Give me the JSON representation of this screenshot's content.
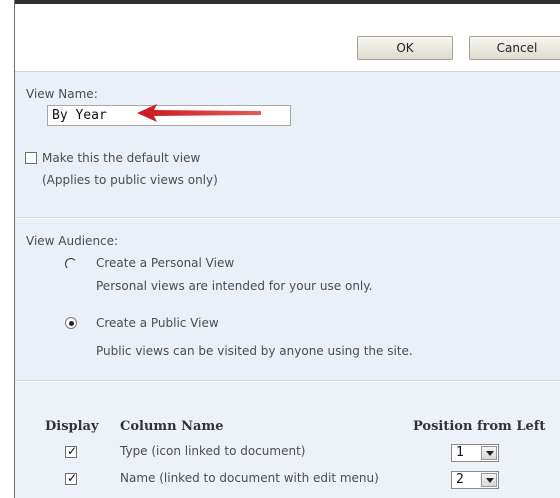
{
  "toolbar": {
    "ok_label": "OK",
    "cancel_label": "Cancel"
  },
  "view_name": {
    "label": "View Name:",
    "value": "By Year",
    "default_checkbox_label": "Make this the default view",
    "default_checkbox_note": "(Applies to public views only)",
    "default_checked": false
  },
  "audience": {
    "label": "View Audience:",
    "personal_label": "Create a Personal View",
    "personal_desc": "Personal views are intended for your use only.",
    "public_label": "Create a Public View",
    "public_desc": "Public views can be visited by anyone using the site.",
    "selected": "public"
  },
  "columns": {
    "headers": {
      "display": "Display",
      "name": "Column Name",
      "position": "Position from Left"
    },
    "rows": [
      {
        "checked": true,
        "name": "Type (icon linked to document)",
        "position": "1"
      },
      {
        "checked": true,
        "name": "Name (linked to document with edit menu)",
        "position": "2"
      }
    ]
  },
  "colors": {
    "section_bg": "#eaf0f8",
    "arrow": "#c8181e"
  }
}
